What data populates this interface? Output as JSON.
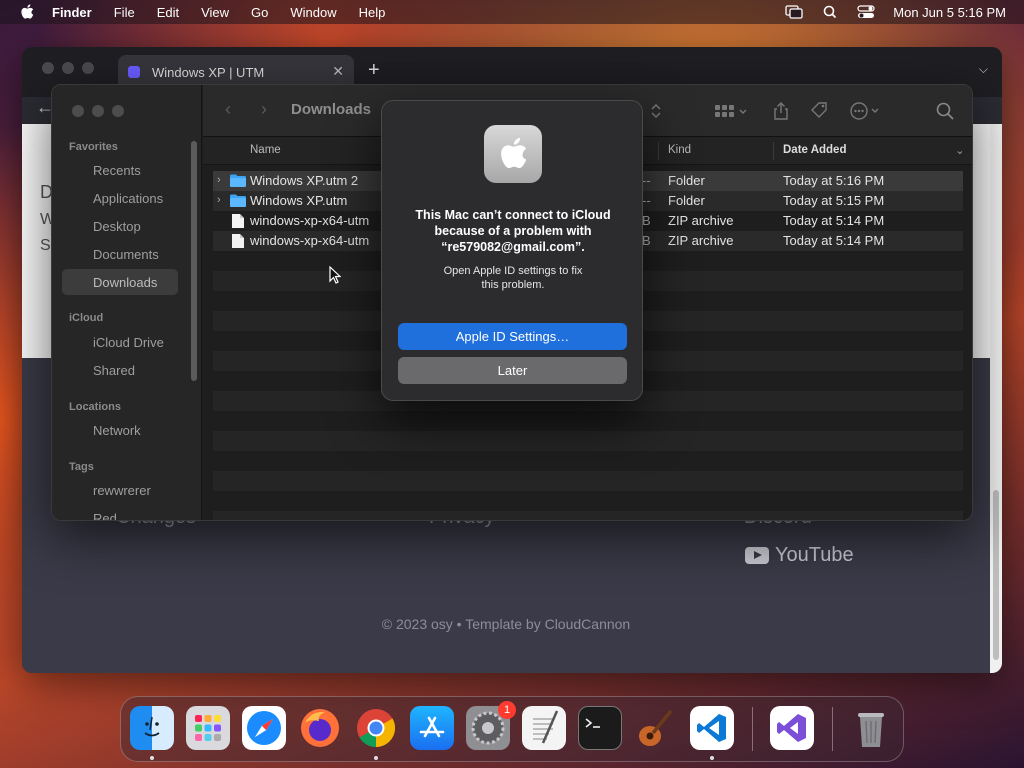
{
  "menubar": {
    "app_name": "Finder",
    "menus": [
      "File",
      "Edit",
      "View",
      "Go",
      "Window",
      "Help"
    ],
    "clock": "Mon Jun 5  5:16 PM",
    "status_icons": [
      "screen-mirroring-icon",
      "spotlight-search-icon",
      "control-center-icon"
    ]
  },
  "browser": {
    "tab_title": "Windows XP | UTM",
    "page_fragments": [
      "D",
      "W",
      "S"
    ],
    "footer": {
      "changes_fragment": "Changes",
      "privacy_fragment": "Privacy",
      "discord_fragment": "Discord",
      "youtube": "YouTube",
      "copyright": "© 2023 osy • Template by CloudCannon"
    }
  },
  "finder": {
    "folder_title": "Downloads",
    "sidebar": {
      "favorites_header": "Favorites",
      "favorites": [
        "Recents",
        "Applications",
        "Desktop",
        "Documents",
        "Downloads"
      ],
      "selected": "Downloads",
      "icloud_header": "iCloud",
      "icloud": [
        "iCloud Drive",
        "Shared"
      ],
      "locations_header": "Locations",
      "locations": [
        "Network"
      ],
      "tags_header": "Tags",
      "tags": [
        "rewwrerer",
        "Red"
      ]
    },
    "columns": {
      "name": "Name",
      "kind": "Kind",
      "date_added": "Date Added"
    },
    "files": [
      {
        "name": "Windows XP.utm 2",
        "size_fragment": "--",
        "kind": "Folder",
        "date": "Today at 5:16 PM",
        "icon": "folder-icon",
        "expandable": true
      },
      {
        "name": "Windows XP.utm",
        "size_fragment": "--",
        "kind": "Folder",
        "date": "Today at 5:15 PM",
        "icon": "folder-icon",
        "expandable": true
      },
      {
        "name": "windows-xp-x64-utm",
        "size_fragment": "B",
        "kind": "ZIP archive",
        "date": "Today at 5:14 PM",
        "icon": "document-icon",
        "expandable": false
      },
      {
        "name": "windows-xp-x64-utm",
        "size_fragment": "B",
        "kind": "ZIP archive",
        "date": "Today at 5:14 PM",
        "icon": "document-icon",
        "expandable": false
      }
    ]
  },
  "alert": {
    "title_lines": [
      "This Mac can’t connect to iCloud",
      "because of a problem with",
      "“re579082@gmail.com”."
    ],
    "message_lines": [
      "Open Apple ID settings to fix",
      "this problem."
    ],
    "primary_button": "Apple ID Settings…",
    "secondary_button": "Later"
  },
  "dock": {
    "apps": [
      "Finder",
      "Launchpad",
      "Safari",
      "Firefox",
      "Chrome",
      "App Store",
      "System Settings",
      "TextEdit",
      "Terminal",
      "GarageBand",
      "Visual Studio Code",
      "Visual Studio",
      "Trash"
    ],
    "system_settings_badge": "1"
  }
}
